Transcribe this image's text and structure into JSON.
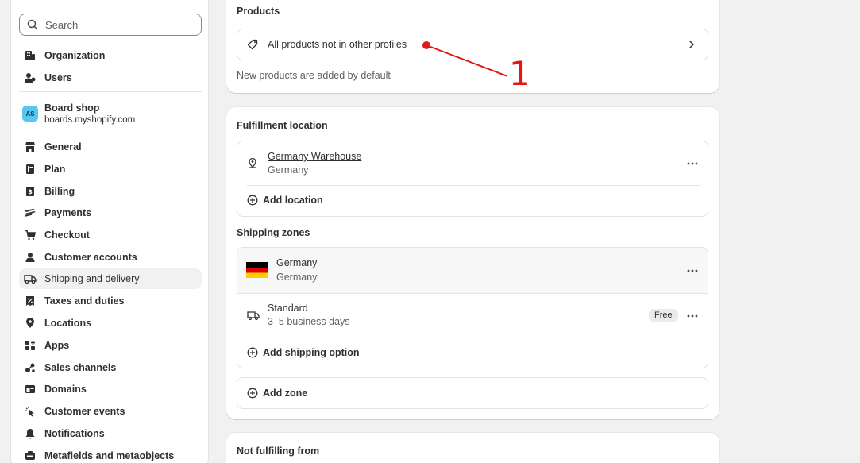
{
  "sidebar": {
    "search_placeholder": "Search",
    "top_items": [
      {
        "label": "Organization",
        "icon": "building-icon"
      },
      {
        "label": "Users",
        "icon": "users-icon"
      }
    ],
    "shop": {
      "initials": "AS",
      "name": "Board shop",
      "domain": "boards.myshopify.com"
    },
    "items": [
      {
        "label": "General",
        "icon": "store-icon"
      },
      {
        "label": "Plan",
        "icon": "plan-icon"
      },
      {
        "label": "Billing",
        "icon": "billing-icon"
      },
      {
        "label": "Payments",
        "icon": "payments-icon"
      },
      {
        "label": "Checkout",
        "icon": "cart-icon"
      },
      {
        "label": "Customer accounts",
        "icon": "person-icon"
      },
      {
        "label": "Shipping and delivery",
        "icon": "truck-icon"
      },
      {
        "label": "Taxes and duties",
        "icon": "tax-icon"
      },
      {
        "label": "Locations",
        "icon": "location-icon"
      },
      {
        "label": "Apps",
        "icon": "apps-icon"
      },
      {
        "label": "Sales channels",
        "icon": "channels-icon"
      },
      {
        "label": "Domains",
        "icon": "globe-icon"
      },
      {
        "label": "Customer events",
        "icon": "cursor-icon"
      },
      {
        "label": "Notifications",
        "icon": "bell-icon"
      },
      {
        "label": "Metafields and metaobjects",
        "icon": "metafield-icon"
      }
    ]
  },
  "products": {
    "title": "Products",
    "row_label": "All products not in other profiles",
    "note": "New products are added by default"
  },
  "fulfillment": {
    "title": "Fulfillment location",
    "location_name": "Germany Warehouse",
    "location_country": "Germany",
    "add_location": "Add location"
  },
  "zones": {
    "title": "Shipping zones",
    "zone_name": "Germany",
    "zone_country": "Germany",
    "rate_name": "Standard",
    "rate_time": "3–5 business days",
    "rate_price": "Free",
    "add_shipping_option": "Add shipping option",
    "add_zone": "Add zone"
  },
  "not_fulfilling": {
    "title": "Not fulfilling from"
  },
  "annotation": {
    "number": "1",
    "color": "#e01818"
  }
}
